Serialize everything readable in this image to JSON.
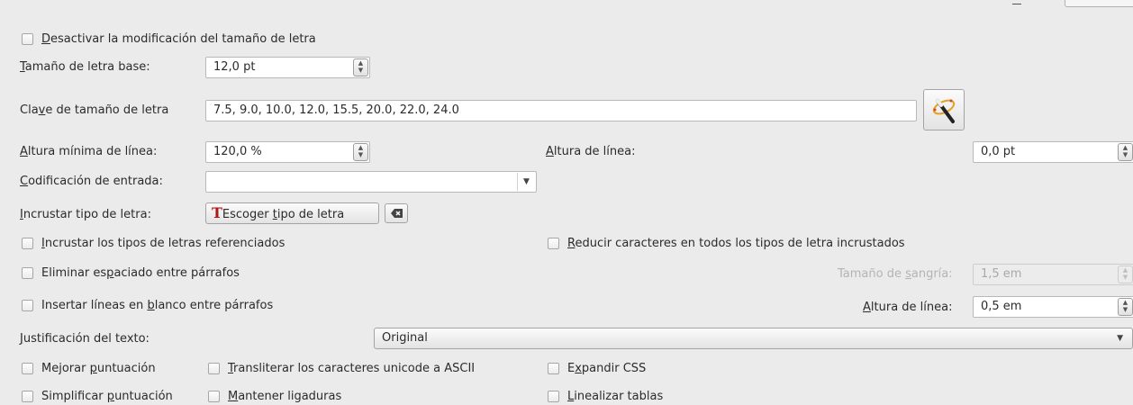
{
  "disable_font_size": {
    "before": "",
    "mn": "D",
    "after": "esactivar la modificación del tamaño de letra"
  },
  "base_font_size": {
    "before": "",
    "mn": "T",
    "after": "amaño de letra base:",
    "value": "12,0 pt"
  },
  "font_size_key": {
    "before": "Cla",
    "mn": "v",
    "after": "e de tamaño de letra",
    "value": "7.5, 9.0, 10.0, 12.0, 15.5, 20.0, 22.0, 24.0",
    "wizard_icon": "magic-wand-icon"
  },
  "min_line_height": {
    "before": "",
    "mn": "A",
    "after": "ltura mínima de línea:",
    "value": "120,0 %"
  },
  "line_height": {
    "before": "",
    "mn": "A",
    "after": "ltura de línea:",
    "value": "0,0 pt"
  },
  "input_encoding": {
    "before": "",
    "mn": "C",
    "after": "odificación de entrada:",
    "value": ""
  },
  "embed_font": {
    "before": "",
    "mn": "I",
    "after": "ncrustar tipo de letra:",
    "button_before": "Escoger ",
    "button_mn": "t",
    "button_after": "ipo de letra",
    "font_icon": "font-icon",
    "clear_icon": "clear-icon"
  },
  "embed_referenced": {
    "before": "",
    "mn": "I",
    "after": "ncrustar los tipos de letras referenciados"
  },
  "subset_fonts": {
    "before": "",
    "mn": "R",
    "after": "educir caracteres en todos los tipos de letra incrustados"
  },
  "remove_spacing": {
    "before": "Eliminar es",
    "mn": "p",
    "after": "aciado entre párrafos"
  },
  "indent_size": {
    "before": "Tamaño de ",
    "mn": "s",
    "after": "angría:",
    "value": "1,5 em"
  },
  "insert_blank": {
    "before": "Insertar líneas en ",
    "mn": "b",
    "after": "lanco entre párrafos"
  },
  "blank_line_height": {
    "before": "",
    "mn": "A",
    "after": "ltura de línea:",
    "value": "0,5 em"
  },
  "justification": {
    "before": "",
    "mn": "J",
    "after": "ustificación del texto:",
    "value": "Original"
  },
  "smarten": {
    "before": "Mejorar ",
    "mn": "p",
    "after": "untuación"
  },
  "transliterate": {
    "before": "",
    "mn": "T",
    "after": "ransliterar los caracteres unicode a ASCII"
  },
  "expand_css": {
    "before": "E",
    "mn": "x",
    "after": "pandir CSS"
  },
  "unsmarten": {
    "before": "Simplificar ",
    "mn": "p",
    "after": "untuación"
  },
  "keep_ligatures": {
    "before": "",
    "mn": "M",
    "after": "antener ligaduras"
  },
  "linearize": {
    "before": "",
    "mn": "L",
    "after": "inealizar tablas"
  },
  "colors": {
    "background": "#ebebeb",
    "field": "#ffffff",
    "disabled_text": "#b4b4b4"
  }
}
